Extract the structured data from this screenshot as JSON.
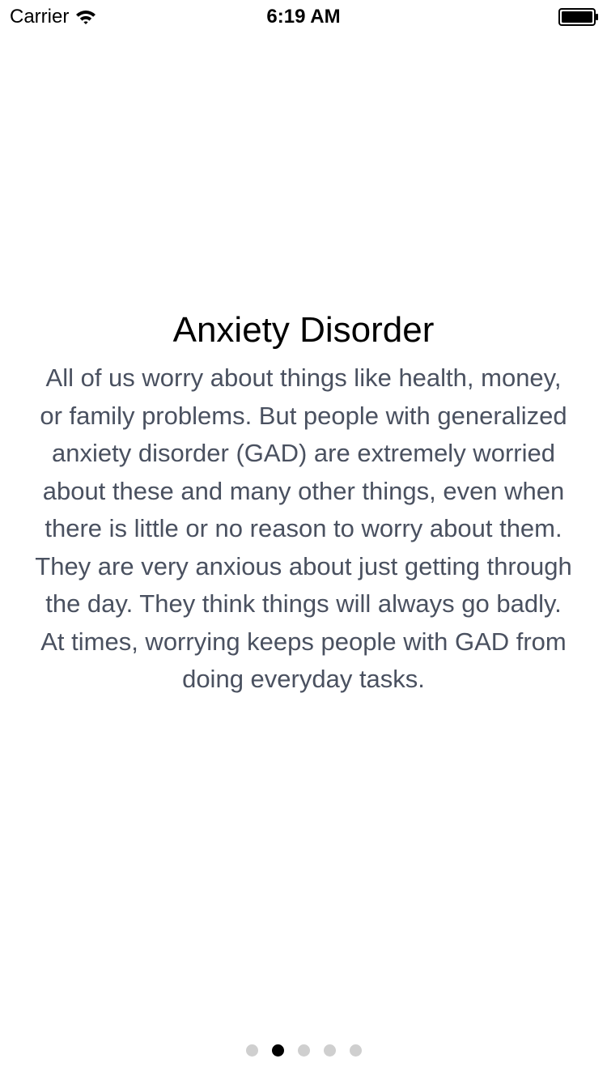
{
  "status_bar": {
    "carrier": "Carrier",
    "time": "6:19 AM",
    "wifi_icon": "wifi-icon",
    "battery_icon": "battery-icon"
  },
  "page": {
    "title": "Anxiety Disorder",
    "body": "All of us worry about things like health, money, or family problems. But people with generalized anxiety disorder (GAD) are extremely worried about these and many other things, even when there is little or no reason to worry about them. They are very anxious about just getting through the day. They think things will always go badly. At times, worrying keeps people with GAD from doing everyday tasks."
  },
  "page_control": {
    "page_count": 5,
    "current_page": 2
  },
  "colors": {
    "background": "#ffffff",
    "title": "#000000",
    "body_text": "#4a5160",
    "dot_active": "#000000",
    "dot_inactive": "#cfcfcf"
  }
}
